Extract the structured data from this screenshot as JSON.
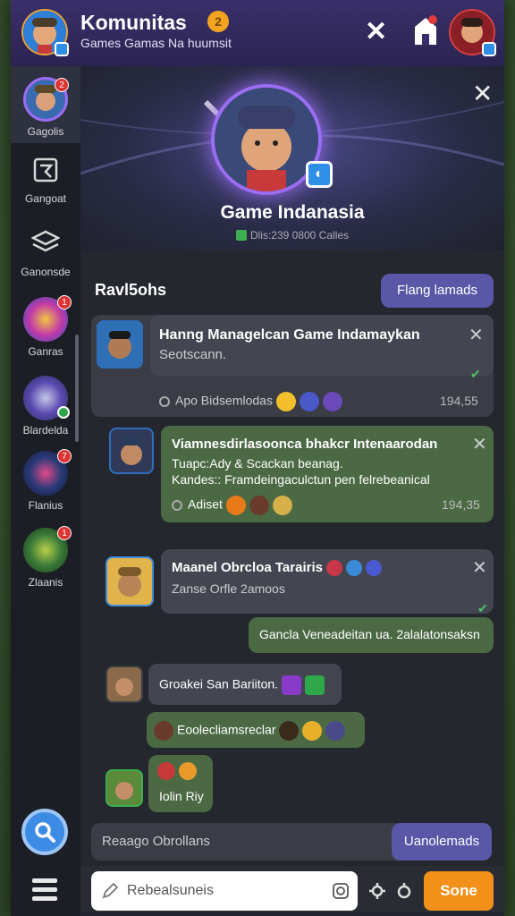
{
  "header": {
    "title": "Komunitas",
    "subtitle": "Games Gamas Na huumsit",
    "coin_label": "2"
  },
  "sidebar": {
    "items": [
      {
        "label": "Gagolis",
        "badge": "2"
      },
      {
        "label": "Gangoat"
      },
      {
        "label": "Ganonsde"
      },
      {
        "label": "Ganras",
        "badge": "1"
      },
      {
        "label": "Blardelda"
      },
      {
        "label": "Flanius",
        "badge": "7"
      },
      {
        "label": "Zlaanis",
        "badge": "1"
      }
    ]
  },
  "hero": {
    "title": "Game Indanasia",
    "subtitle": "Dlis:239 0800 Calles"
  },
  "chat": {
    "section_title": "Ravl5ohs",
    "section_button": "Flang lamads",
    "messages": [
      {
        "title": "Hanng Managelcan Game Indamaykan",
        "body": "Seotscann.",
        "footer": "Apo Bidsemlodas",
        "time": "194,55"
      },
      {
        "title": "Viamnesdirlasoonca bhakcr Intenaarodan",
        "body": "Tuapc:Ady & Scackan beanag.",
        "body2": "Kandes:: Framdeingaculctun pen felrebeanical",
        "footer": "Adiset",
        "time": "194,35"
      },
      {
        "title": "Maanel Obrcloa Tarairis",
        "body": "Zanse Orfle 2amoos"
      },
      {
        "reply": "Gancla Veneadeitan ua. 2alalatonsaksn"
      },
      {
        "text": "Groakei San Bariiton."
      },
      {
        "text": "Eoolecliamsreclar"
      },
      {
        "text": "Iolin Riy"
      }
    ],
    "reply_placeholder": "Reaago Obrollans",
    "reply_button": "Uanolemads",
    "input_placeholder": "Rebealsuneis",
    "send_button": "Sone"
  }
}
